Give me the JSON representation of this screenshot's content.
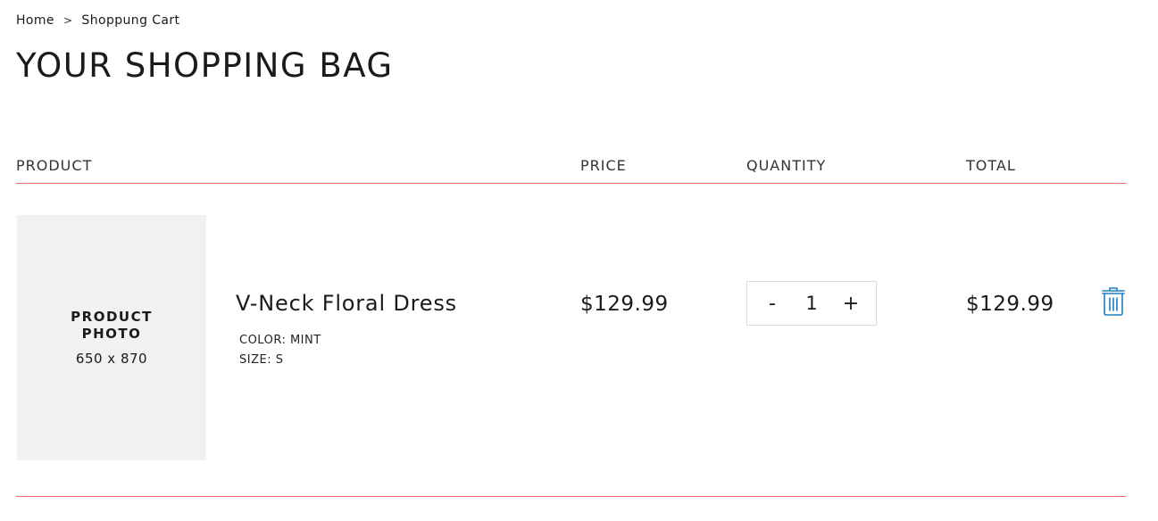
{
  "breadcrumb": {
    "home": "Home",
    "separator": ">",
    "current": "Shoppung Cart"
  },
  "page_title": "YOUR SHOPPING BAG",
  "table": {
    "headers": {
      "product": "PRODUCT",
      "price": "PRICE",
      "quantity": "QUANTITY",
      "total": "TOTAL"
    },
    "divider_color": "#f0686a"
  },
  "items": [
    {
      "photo_label": "PRODUCT PHOTO",
      "photo_size": "650 x 870",
      "name": "V-Neck Floral Dress",
      "color": "COLOR: MINT",
      "size": "SIZE: S",
      "price": "$129.99",
      "quantity": "1",
      "decrement_label": "-",
      "increment_label": "+",
      "total": "$129.99",
      "remove_icon": "trash-icon"
    }
  ],
  "accent_color": "#1b7fc4"
}
